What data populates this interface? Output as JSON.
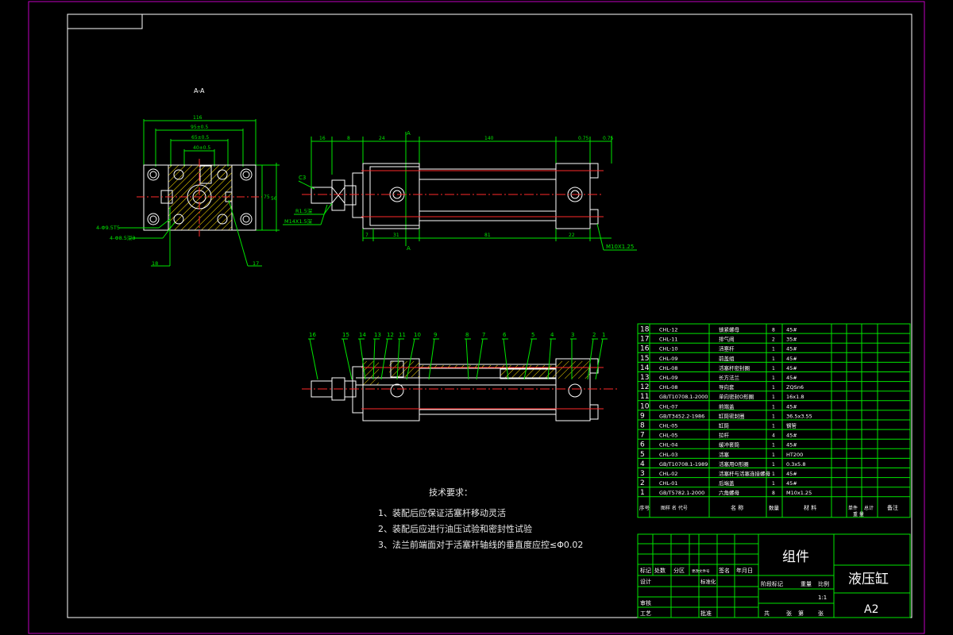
{
  "title_block": {
    "group_label": "组件",
    "drawing_name": "液压缸",
    "sheet_size": "A2",
    "scale": "1:1",
    "row_labels": {
      "biaoji": "标记",
      "chushu": "处数",
      "fenqu": "分区",
      "gengai": "更改文件号",
      "qianming": "签名",
      "riqi": "年月日",
      "sheji": "设计",
      "biaozhunhua": "标准化",
      "shenhe": "审核",
      "gongyi": "工艺",
      "pizhun": "批准",
      "jieduan": "阶段标记",
      "zhongliang": "重量",
      "bili": "比例",
      "gong": "共",
      "zhang": "张",
      "di": "第",
      "zhang2": "张"
    }
  },
  "parts_header": {
    "xuhao": "序号",
    "daihao": "图样 名 代号",
    "mingcheng": "名 称",
    "shuliang": "数量",
    "cailiao": "材 料",
    "danjian": "单件",
    "zongji": "总计",
    "zhongliang": "重 量",
    "beizhu": "备注"
  },
  "parts": [
    {
      "no": "18",
      "code": "CHL-12",
      "name": "锁紧螺母",
      "qty": "8",
      "material": "45#"
    },
    {
      "no": "17",
      "code": "CHL-11",
      "name": "排气阀",
      "qty": "2",
      "material": "35#"
    },
    {
      "no": "16",
      "code": "CHL-10",
      "name": "活塞杆",
      "qty": "1",
      "material": "45#"
    },
    {
      "no": "15",
      "code": "CHL-09",
      "name": "前盖组",
      "qty": "1",
      "material": "45#"
    },
    {
      "no": "14",
      "code": "CHL-08",
      "name": "活塞杆密封圈",
      "qty": "1",
      "material": "45#"
    },
    {
      "no": "13",
      "code": "CHL-09",
      "name": "长方法兰",
      "qty": "1",
      "material": "45#"
    },
    {
      "no": "12",
      "code": "CHL-08",
      "name": "导向套",
      "qty": "1",
      "material": "ZQSn6"
    },
    {
      "no": "11",
      "code": "GB/T10708.1-2000",
      "name": "单向密封O形圈",
      "qty": "1",
      "material": "16x1.8"
    },
    {
      "no": "10",
      "code": "CHL-07",
      "name": "前端盖",
      "qty": "1",
      "material": "45#"
    },
    {
      "no": "9",
      "code": "GB/T3452.2-1986",
      "name": "缸筒密封圈",
      "qty": "1",
      "material": "36.5x3.55"
    },
    {
      "no": "8",
      "code": "CHL-05",
      "name": "缸筒",
      "qty": "1",
      "material": "钢管"
    },
    {
      "no": "7",
      "code": "CHL-05",
      "name": "拉杆",
      "qty": "4",
      "material": "45#"
    },
    {
      "no": "6",
      "code": "CHL-04",
      "name": "缓冲套筒",
      "qty": "1",
      "material": "45#"
    },
    {
      "no": "5",
      "code": "CHL-03",
      "name": "活塞",
      "qty": "1",
      "material": "HT200"
    },
    {
      "no": "4",
      "code": "GB/T10708.1-1989",
      "name": "活塞用O形圈",
      "qty": "1",
      "material": "0.3x5.8"
    },
    {
      "no": "3",
      "code": "CHL-02",
      "name": "活塞杆与活塞连接螺母",
      "qty": "1",
      "material": "45#"
    },
    {
      "no": "2",
      "code": "CHL-01",
      "name": "后端盖",
      "qty": "1",
      "material": "45#"
    },
    {
      "no": "1",
      "code": "GB/T5782.1-2000",
      "name": "六角螺母",
      "qty": "8",
      "material": "M10x1.25"
    }
  ],
  "notes": {
    "title": "技术要求：",
    "items": [
      "1、装配后应保证活塞杆移动灵活",
      "2、装配后应进行油压试验和密封性试验",
      "3、法兰前端面对于活塞杆轴线的垂直度应控≤Φ0.02"
    ]
  },
  "section_label": "A-A",
  "cut_labels": [
    "A",
    "A"
  ],
  "dims_end_view": [
    "116",
    "95±0.5",
    "65±0.5",
    "40±0.5",
    "75",
    "56"
  ],
  "dims_side_view": [
    "16",
    "8",
    "24",
    "140",
    "0.75",
    "0.75",
    "7",
    "31",
    "81",
    "22"
  ],
  "callouts": {
    "c3": "C3",
    "m14": "M14X1.5深",
    "r1": "R1.5深",
    "m10": "M10X1.25",
    "hole1": "4-Φ9.5T5",
    "hole2": "4-Φ8.5深3",
    "p18": "18",
    "p17": "17"
  },
  "balloons": [
    "16",
    "15",
    "14",
    "13",
    "12",
    "11",
    "10",
    "9",
    "8",
    "7",
    "6",
    "5",
    "4",
    "3",
    "2",
    "1"
  ],
  "colors": {
    "frame": "#ffffff",
    "dims": "#00e600",
    "center": "#ff2a2a",
    "table": "#00e600",
    "hatch": "#ffe000"
  }
}
